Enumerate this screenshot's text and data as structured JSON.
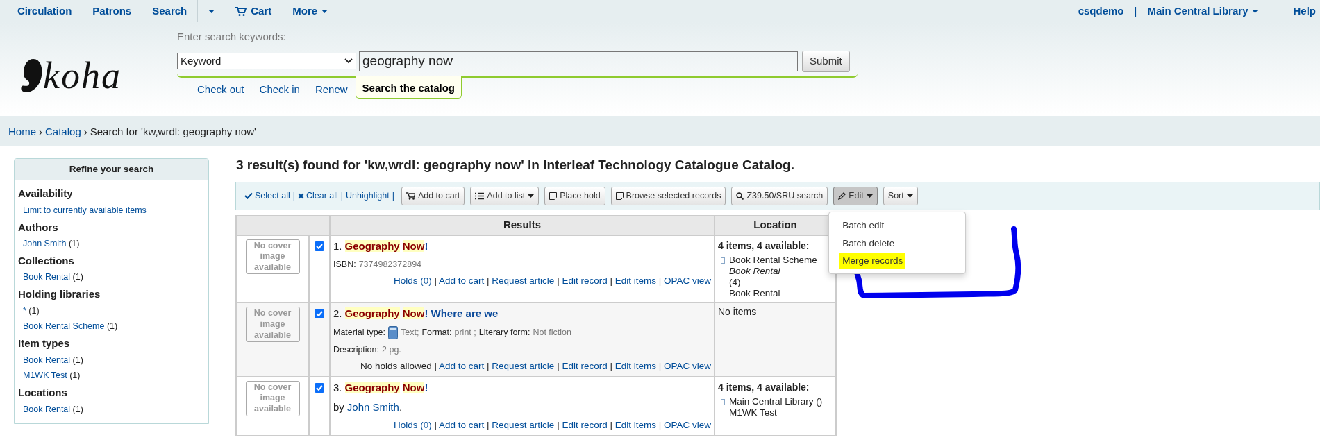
{
  "top_nav": {
    "left": [
      {
        "label": "Circulation",
        "kind": "link"
      },
      {
        "label": "Patrons",
        "kind": "link"
      },
      {
        "label": "Search",
        "kind": "link"
      },
      {
        "kind": "caret"
      },
      {
        "label": "Cart",
        "kind": "cart"
      },
      {
        "label": "More",
        "kind": "menu"
      }
    ],
    "user": "csqdemo",
    "separator": "|",
    "library": "Main Central Library",
    "help": "Help"
  },
  "logo": {
    "text": "koha"
  },
  "search": {
    "prompt": "Enter search keywords:",
    "index": "Keyword",
    "query": "geography now",
    "submit": "Submit",
    "tabs": [
      {
        "label": "Check out",
        "selected": false
      },
      {
        "label": "Check in",
        "selected": false
      },
      {
        "label": "Renew",
        "selected": false
      },
      {
        "label": "Search the catalog",
        "selected": true
      }
    ]
  },
  "breadcrumb": {
    "separator": "›",
    "items": [
      {
        "label": "Home",
        "link": true
      },
      {
        "label": "Catalog",
        "link": true
      },
      {
        "label": "Search for 'kw,wrdl: geography now'",
        "link": false
      }
    ]
  },
  "sidebar": {
    "title": "Refine your search",
    "sections": [
      {
        "title": "Availability",
        "items": [
          {
            "label": "Limit to currently available items"
          }
        ]
      },
      {
        "title": "Authors",
        "items": [
          {
            "label": "John Smith",
            "count": "(1)"
          }
        ]
      },
      {
        "title": "Collections",
        "items": [
          {
            "label": "Book Rental",
            "count": "(1)"
          }
        ]
      },
      {
        "title": "Holding libraries",
        "items": [
          {
            "label": "*",
            "count": "(1)"
          },
          {
            "label": "Book Rental Scheme",
            "count": "(1)"
          }
        ]
      },
      {
        "title": "Item types",
        "items": [
          {
            "label": "Book Rental",
            "count": "(1)"
          },
          {
            "label": "M1WK Test",
            "count": "(1)"
          }
        ]
      },
      {
        "title": "Locations",
        "items": [
          {
            "label": "Book Rental",
            "count": "(1)"
          }
        ]
      }
    ]
  },
  "heading": "3 result(s) found for 'kw,wrdl: geography now' in Interleaf Technology Catalogue Catalog.",
  "toolbar": {
    "links": [
      {
        "label": "Select all",
        "kind": "check"
      },
      {
        "label": "Clear all",
        "kind": "clear"
      },
      {
        "label": "Unhighlight",
        "kind": "plain"
      }
    ],
    "separator": "|",
    "buttons": [
      {
        "label": "Add to cart",
        "kind": "cart",
        "caret": false,
        "active": false
      },
      {
        "label": "Add to list",
        "kind": "list",
        "caret": true,
        "active": false
      },
      {
        "label": "Place hold",
        "kind": "note",
        "caret": false,
        "active": false
      },
      {
        "label": "Browse selected records",
        "kind": "note",
        "caret": false,
        "active": false
      },
      {
        "label": "Z39.50/SRU search",
        "kind": "search",
        "caret": false,
        "active": false
      },
      {
        "label": "Edit",
        "kind": "edit",
        "caret": true,
        "active": true
      },
      {
        "label": "Sort",
        "kind": "plain",
        "caret": true,
        "active": false
      }
    ],
    "edit_menu": [
      {
        "label": "Batch edit",
        "highlighted": false
      },
      {
        "label": "Batch delete",
        "highlighted": false
      },
      {
        "label": "Merge records",
        "highlighted": true
      }
    ]
  },
  "table": {
    "columns": [
      "Results",
      "Location"
    ],
    "rows": [
      {
        "cover": "No cover image available",
        "selected": true,
        "number": "1.",
        "title": [
          {
            "text": "Geography",
            "highlighted": true
          },
          {
            "text": "Now",
            "highlighted": true
          },
          {
            "text": "!",
            "highlighted": false
          }
        ],
        "details": [
          [
            {
              "kind": "label",
              "text": "ISBN:"
            },
            {
              "kind": "value",
              "text": "7374982372894"
            }
          ]
        ],
        "actions": [
          {
            "kind": "link",
            "text": "Holds (0)"
          },
          {
            "kind": "link",
            "text": "Add to cart"
          },
          {
            "kind": "link",
            "text": "Request article"
          },
          {
            "kind": "link",
            "text": "Edit record"
          },
          {
            "kind": "link",
            "text": "Edit items"
          },
          {
            "kind": "link",
            "text": "OPAC view"
          }
        ],
        "location": {
          "summary": "4 items, 4 available:",
          "entries": [
            {
              "lines": [
                {
                  "text": "Book Rental Scheme",
                  "italic": false
                },
                {
                  "text": "Book Rental",
                  "italic": true
                },
                {
                  "text": "(4)",
                  "italic": false
                },
                {
                  "text": "Book Rental",
                  "italic": false
                }
              ]
            }
          ]
        }
      },
      {
        "cover": "No cover image available",
        "selected": true,
        "number": "2.",
        "title": [
          {
            "text": "Geography",
            "highlighted": true
          },
          {
            "text": "Now",
            "highlighted": true
          },
          {
            "text": "! Where are we",
            "highlighted": false
          }
        ],
        "details": [
          [
            {
              "kind": "label",
              "text": "Material type:"
            },
            {
              "kind": "icon"
            },
            {
              "kind": "value",
              "text": "Text;"
            },
            {
              "kind": "label",
              "text": "Format:"
            },
            {
              "kind": "value",
              "text": "print ;"
            },
            {
              "kind": "label",
              "text": "Literary form:"
            },
            {
              "kind": "value",
              "text": "Not fiction"
            }
          ],
          [
            {
              "kind": "label",
              "text": "Description:"
            },
            {
              "kind": "value",
              "text": "2 pg."
            }
          ]
        ],
        "actions": [
          {
            "kind": "text",
            "text": "No holds allowed"
          },
          {
            "kind": "link",
            "text": "Add to cart"
          },
          {
            "kind": "link",
            "text": "Request article"
          },
          {
            "kind": "link",
            "text": "Edit record"
          },
          {
            "kind": "link",
            "text": "Edit items"
          },
          {
            "kind": "link",
            "text": "OPAC view"
          }
        ],
        "location": {
          "summary": "No items"
        }
      },
      {
        "cover": "No cover image available",
        "selected": true,
        "number": "3.",
        "title": [
          {
            "text": "Geography",
            "highlighted": true
          },
          {
            "text": "Now",
            "highlighted": true
          },
          {
            "text": "!",
            "highlighted": false
          }
        ],
        "details": [
          [
            {
              "kind": "text",
              "text": "by"
            },
            {
              "kind": "link",
              "text": "John Smith"
            },
            {
              "kind": "text",
              "text": "."
            }
          ]
        ],
        "actions": [
          {
            "kind": "link",
            "text": "Holds (0)"
          },
          {
            "kind": "link",
            "text": "Add to cart"
          },
          {
            "kind": "link",
            "text": "Request article"
          },
          {
            "kind": "link",
            "text": "Edit record"
          },
          {
            "kind": "link",
            "text": "Edit items"
          },
          {
            "kind": "link",
            "text": "OPAC view"
          }
        ],
        "location": {
          "summary": "4 items, 4 available:",
          "entries": [
            {
              "lines": [
                {
                  "text": "Main Central Library ()",
                  "italic": false
                },
                {
                  "text": "M1WK Test",
                  "italic": false
                }
              ]
            }
          ]
        }
      }
    ],
    "separator": "|"
  }
}
